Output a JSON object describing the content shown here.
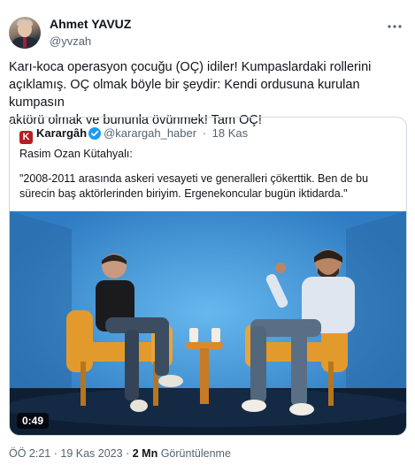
{
  "author": {
    "name": "Ahmet YAVUZ",
    "handle": "@yvzah",
    "more_icon": "more-horizontal-icon"
  },
  "tweet": {
    "line1": "Karı-koca operasyon çocuğu (OÇ) idiler! Kumpaslardaki rollerini",
    "line2": "açıklamış. OÇ olmak böyle bir şeydir: Kendi ordusuna kurulan kumpasın",
    "line3": "aktörü olmak ve bununla övünmek! Tam OÇ!"
  },
  "quote": {
    "logo_letter": "K",
    "name": "Karargâh",
    "handle": "@karargah_haber",
    "separator": "·",
    "date": "18 Kas",
    "speaker": "Rasim Ozan Kütahyalı:",
    "quote_line1": "\"2008-2011 arasında askeri vesayeti ve generalleri çökerttik. Ben de bu",
    "quote_line2": "sürecin baş aktörlerinden biriyim. Ergenekoncular bugün iktidarda.\"",
    "video_duration": "0:49",
    "verified_color": "#1d9bf0"
  },
  "meta": {
    "time": "ÖÖ 2:21",
    "dot1": "·",
    "date": "19 Kas 2023",
    "dot2": "·",
    "views": "2 Mn",
    "views_label": "Görüntülenme"
  }
}
